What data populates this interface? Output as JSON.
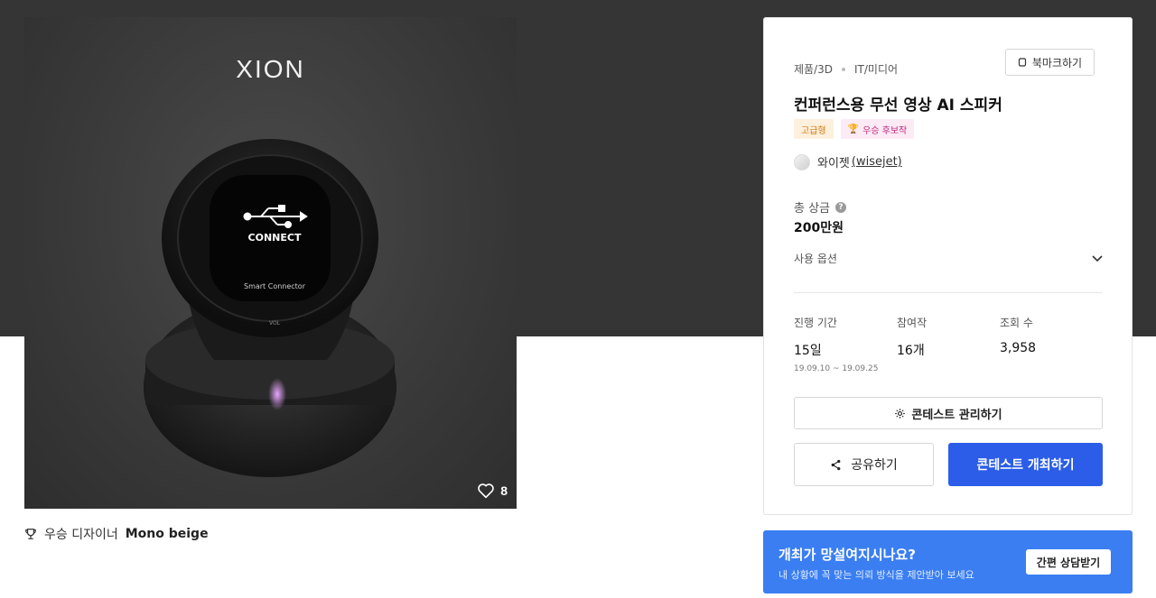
{
  "hero": {
    "brand": "XION",
    "device_label_main": "CONNECT",
    "device_label_sub": "Smart Connector",
    "device_vol": "VOL",
    "like_count": "8"
  },
  "award": {
    "label": "우승 디자이너",
    "designer": "Mono beige"
  },
  "card": {
    "categories": [
      "제품/3D",
      "IT/미디어"
    ],
    "bookmark_label": "북마크하기",
    "title": "컨퍼런스용 무선 영상 AI 스피커",
    "badges": {
      "grade": "고급형",
      "winner": "우승 후보작"
    },
    "owner": {
      "name": "와이젯",
      "handle": "(wisejet)"
    },
    "prize_label": "총 상금",
    "prize_value": "200만원",
    "usage_label": "사용 옵션",
    "stats": [
      {
        "label": "진행 기간",
        "value": "15일",
        "sub": "19.09.10 ~ 19.09.25"
      },
      {
        "label": "참여작",
        "value": "16개",
        "sub": ""
      },
      {
        "label": "조회 수",
        "value": "3,958",
        "sub": ""
      }
    ],
    "manage_label": "콘테스트 관리하기",
    "share_label": "공유하기",
    "host_label": "콘테스트 개최하기"
  },
  "consult": {
    "title": "개최가 망설여지시나요?",
    "subtitle": "내 상황에 꼭 맞는 의뢰 방식을 제안받아 보세요",
    "button": "간편 상담받기"
  },
  "colors": {
    "band": "#353535",
    "primary": "#2b5de8",
    "banner": "#3a7ef2"
  }
}
